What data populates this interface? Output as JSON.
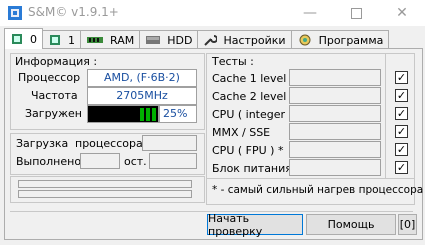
{
  "window": {
    "title": "S&M© v1.9.1+"
  },
  "tabs": [
    {
      "label": "0",
      "icon": "cpu-icon",
      "active": true
    },
    {
      "label": "1",
      "icon": "cpu-icon"
    },
    {
      "label": "RAM",
      "icon": "ram-icon"
    },
    {
      "label": "HDD",
      "icon": "hdd-icon"
    },
    {
      "label": "Настройки",
      "icon": "wrench-icon"
    },
    {
      "label": "Программа",
      "icon": "program-icon"
    }
  ],
  "info": {
    "heading": "Информация :",
    "processor_label": "Процессор",
    "processor_value": "AMD, (F·6B·2)",
    "freq_label": "Частота",
    "freq_value": "2705MHz",
    "load_label": "Загружен",
    "load_percent": "25%",
    "load_fraction": 0.25
  },
  "progress": {
    "cpu_load_label": "Загрузка",
    "cpu_load_label2": "процессора",
    "done_label": "Выполнено",
    "left_label": "ост."
  },
  "tests": {
    "heading": "Тесты :",
    "items": [
      {
        "label": "Cache 1 level",
        "checked": true
      },
      {
        "label": "Cache 2 level",
        "checked": true
      },
      {
        "label": "CPU ( integer )",
        "checked": true
      },
      {
        "label": "MMX  /  SSE",
        "checked": true
      },
      {
        "label": "CPU ( FPU ) *",
        "checked": true
      },
      {
        "label": "Блок питания",
        "checked": true
      }
    ],
    "footnote": "* - самый сильный нагрев процессора"
  },
  "buttons": {
    "start": "Начать проверку",
    "help": "Помощь",
    "counter": "[0]"
  },
  "colors": {
    "accent": "#0078d7",
    "value_text": "#1a4fa0",
    "load_bar": "#00b000"
  }
}
